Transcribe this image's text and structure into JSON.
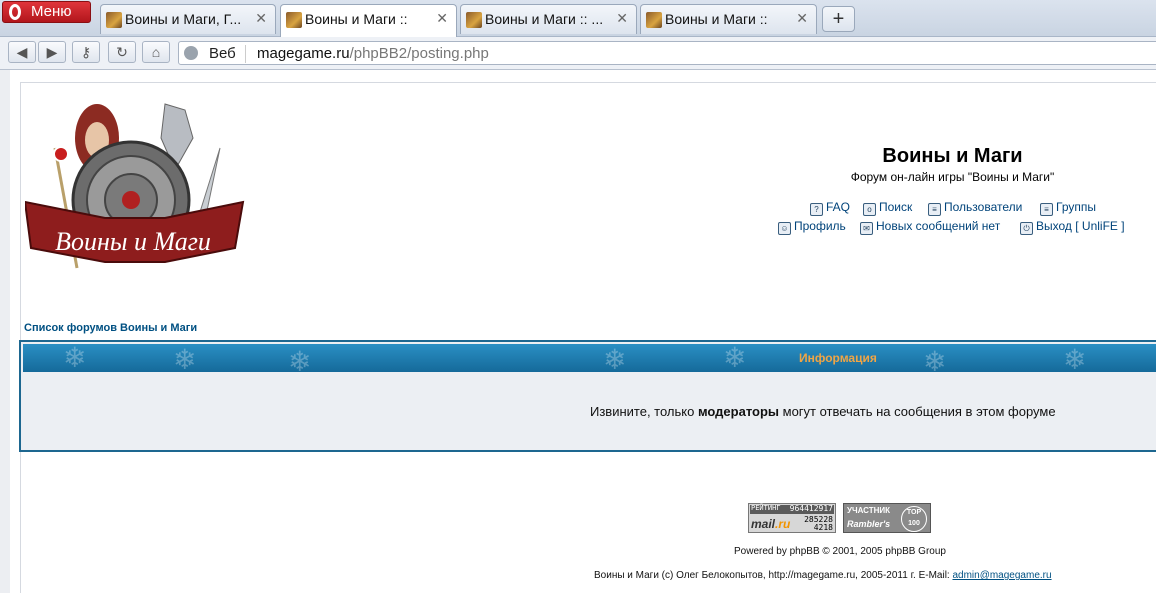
{
  "browser": {
    "menu_label": "Меню",
    "tabs": [
      {
        "title": "Воины и Маги, Г...",
        "active": false
      },
      {
        "title": "Воины и Маги ::",
        "active": true
      },
      {
        "title": "Воины и Маги :: ...",
        "active": false
      },
      {
        "title": "Воины и Маги ::",
        "active": false
      }
    ],
    "new_tab_label": "+",
    "address": {
      "scope_label": "Веб",
      "domain": "magegame.ru",
      "path": "/phpBB2/posting.php"
    }
  },
  "header": {
    "logo_text": "Воины и Маги",
    "site_title": "Воины и Маги",
    "site_description": "Форум он-лайн игры \"Воины и Маги\"",
    "links_row1": [
      "FAQ",
      "Поиск",
      "Пользователи",
      "Группы"
    ],
    "links_row2": [
      "Профиль",
      "Новых сообщений нет",
      "Выход [ UnliFE ]"
    ]
  },
  "breadcrumb": "Список форумов Воины и Маги",
  "info": {
    "title": "Информация",
    "message_before": "Извините, только ",
    "message_bold": "модераторы",
    "message_after": " могут отвечать на сообщения в этом форуме"
  },
  "footer": {
    "badge_mail": {
      "label": "РЕЙТИНГ",
      "value1": "964412917",
      "value2": "285228",
      "value3": "4218",
      "brand_a": "mail",
      "brand_b": ".ru"
    },
    "badge_rambler": {
      "line1": "УЧАСТНИК",
      "line2": "Rambler's",
      "circle": "TOP 100"
    },
    "powered": "Powered by phpBB © 2001, 2005 phpBB Group",
    "copyright": "Воины и Маги (c) Олег Белокопытов, http://magegame.ru, 2005-2011 г. E-Mail: ",
    "email": "admin@magegame.ru"
  },
  "colors": {
    "accent": "#1d6790",
    "link": "#00437a",
    "info_title": "#f0a545"
  }
}
